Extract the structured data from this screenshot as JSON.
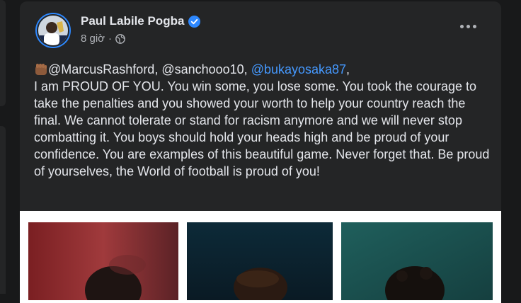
{
  "post": {
    "author": "Paul Labile Pogba",
    "timestamp": "8 giờ",
    "privacy_icon": "globe-icon",
    "verified_icon": "verified-badge-icon",
    "more_icon": "more-options-icon",
    "mentions": {
      "first": "@MarcusRashford, @sanchooo10, ",
      "linked": "@bukayosaka87",
      "trailing": ","
    },
    "body": "I am PROUD OF YOU. You win some, you lose some. You took the courage to take the penalties and you showed your worth to help your country reach the final. We cannot tolerate or stand for racism anymore and we will never stop combatting it. You boys should hold your heads high and be proud of your confidence. You are examples of this beautiful game. Never forget that. Be proud of yourselves, the World of football is proud of you!"
  },
  "colors": {
    "page_bg": "#18191a",
    "card_bg": "#242526",
    "text_primary": "#e4e6eb",
    "text_secondary": "#b0b3b8",
    "link": "#4599ff",
    "verified": "#2d88ff"
  }
}
